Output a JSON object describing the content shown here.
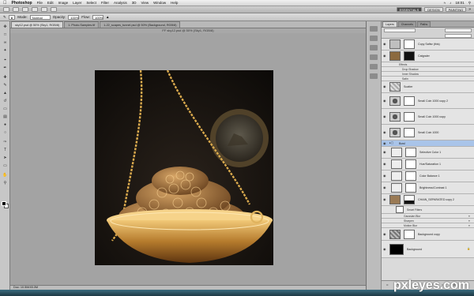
{
  "menubar": {
    "app": "Photoshop",
    "menus": [
      "File",
      "Edit",
      "Image",
      "Layer",
      "Select",
      "Filter",
      "Analysis",
      "3D",
      "View",
      "Window",
      "Help"
    ],
    "clock": "18:01"
  },
  "appbar": {
    "workspaces": [
      "ESSENTIALS",
      "DESIGN",
      "PAINTING"
    ],
    "active_workspace": "ESSENTIALS"
  },
  "options": {
    "mode_label": "Mode:",
    "mode_value": "Normal",
    "opacity_label": "Opacity:",
    "opacity_value": "100%",
    "flow_label": "Flow:",
    "flow_value": "100%"
  },
  "document": {
    "tabs": [
      "sky12.psd @ 50% (Sky1, RGB/8)",
      "1. Photo.Samples.tif",
      "1-22_scapes_tunnel.psd @ 50% (Background, RGB/8)"
    ],
    "title": "FF sky12.psd @ 50% (Sky1, RGB/8)",
    "status": "Doc: 10.5M/45.0M"
  },
  "panels": {
    "tabs": [
      "Layers",
      "Channels",
      "Paths"
    ],
    "active_tab": "Layers",
    "layers": [
      {
        "name": "Copy Saftsr (this)",
        "kind": "plain"
      },
      {
        "name": "Catgraler",
        "kind": "image"
      },
      {
        "name": "Effects",
        "kind": "fx"
      },
      {
        "name": "Drop Shadow",
        "kind": "fx"
      },
      {
        "name": "Inner Shadow",
        "kind": "fx"
      },
      {
        "name": "Satin",
        "kind": "fx"
      },
      {
        "name": "Scatter",
        "kind": "pattern"
      },
      {
        "name": "Small Coin 1000 copy 2",
        "kind": "coin"
      },
      {
        "name": "Small Coin 1000 copy",
        "kind": "coin"
      },
      {
        "name": "Small Coin 1000",
        "kind": "coin"
      },
      {
        "name": "Bowl",
        "kind": "group"
      },
      {
        "name": "Selective Color 1",
        "kind": "adjust"
      },
      {
        "name": "Hue/Saturation 1",
        "kind": "adjust"
      },
      {
        "name": "Color Balance 1",
        "kind": "adjust"
      },
      {
        "name": "Brightness/Contrast 1",
        "kind": "adjust"
      },
      {
        "name": "CHAIN_SEPARATED copy 2",
        "kind": "chain"
      },
      {
        "name": "Smart Filters",
        "kind": "fx"
      },
      {
        "name": "Gaussian Blur",
        "kind": "fx"
      },
      {
        "name": "Sharpen",
        "kind": "fx"
      },
      {
        "name": "Motion Blur",
        "kind": "fx"
      },
      {
        "name": "Background copy",
        "kind": "image"
      },
      {
        "name": "Background",
        "kind": "black"
      }
    ]
  },
  "watermark": "pxleyes.com",
  "colors": {
    "accent_selection": "#a9c4e9",
    "gold": "#c8953f"
  },
  "icons": [
    "move-tool-icon",
    "marquee-tool-icon",
    "lasso-tool-icon",
    "magic-wand-icon",
    "crop-tool-icon",
    "eyedropper-icon",
    "healing-brush-icon",
    "brush-tool-icon",
    "clone-stamp-icon",
    "history-brush-icon",
    "eraser-icon",
    "gradient-icon",
    "blur-tool-icon",
    "dodge-tool-icon",
    "pen-tool-icon",
    "type-tool-icon",
    "path-select-icon",
    "shape-tool-icon",
    "hand-tool-icon",
    "zoom-tool-icon"
  ]
}
